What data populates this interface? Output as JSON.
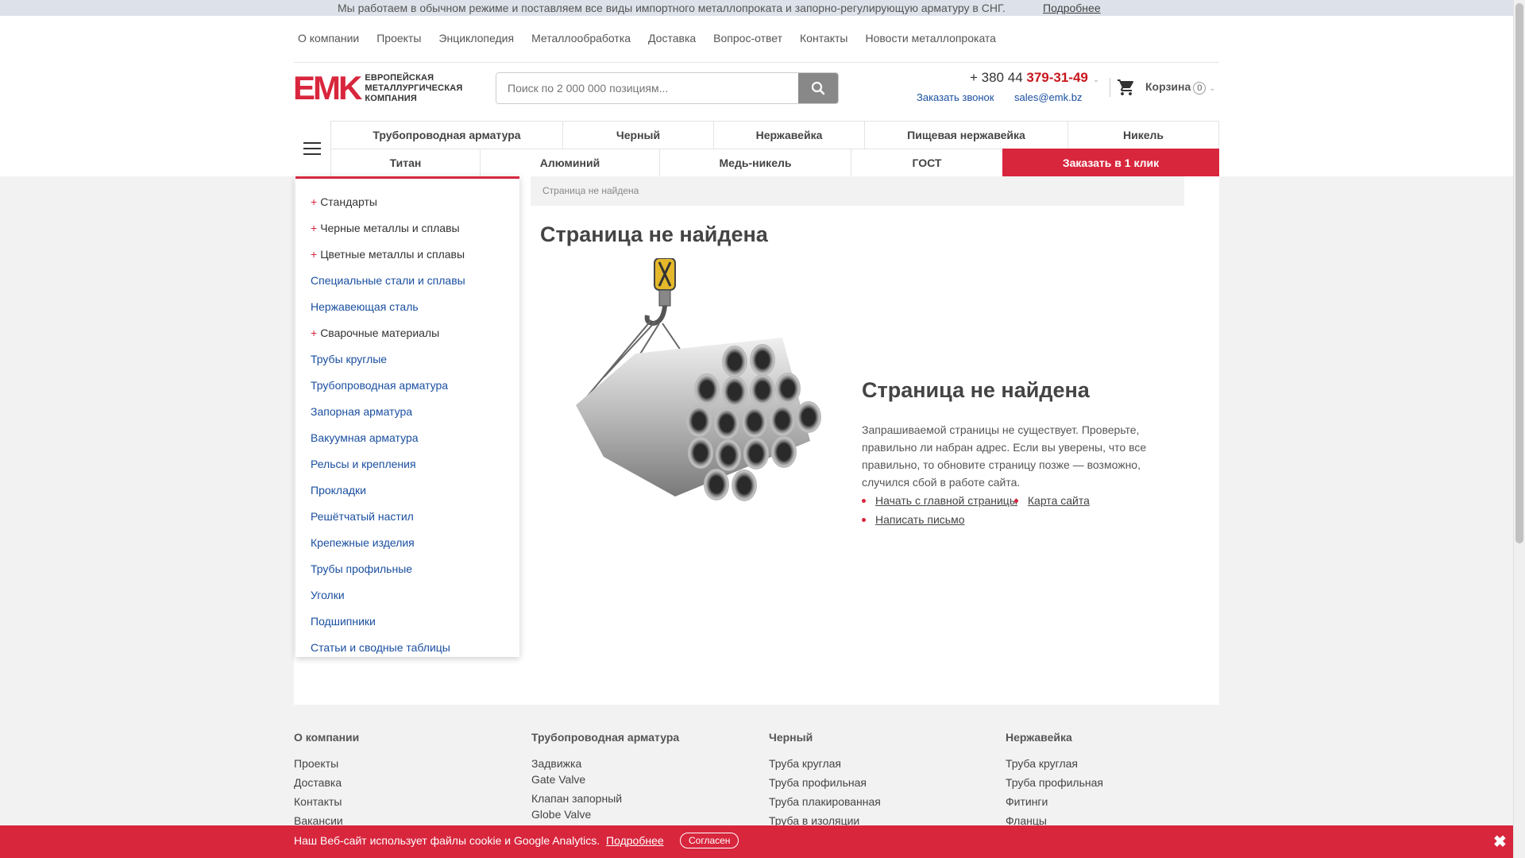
{
  "topbar": {
    "message": "Мы работаем в обычном режиме и поставляем все виды импортного металлопроката и запорно-регулирующую арматуру в СНГ.",
    "more": "Подробнее"
  },
  "topnav": [
    "О компании",
    "Проекты",
    "Энциклопедия",
    "Металлообработка",
    "Доставка",
    "Вопрос-ответ",
    "Контакты",
    "Новости металлопроката"
  ],
  "logo": {
    "mark": "EMK",
    "line1": "ЕВРОПЕЙСКАЯ",
    "line2": "МЕТАЛЛУРГИЧЕСКАЯ",
    "line3": "КОМПАНИЯ"
  },
  "search": {
    "placeholder": "Поиск по 2 000 000 позициям...",
    "icon": "search-icon"
  },
  "contacts": {
    "phone_prefix": "+ 380 44 ",
    "phone_main": "379-31-49",
    "callback": "Заказать звонок",
    "email": "sales@emk.bz"
  },
  "cart": {
    "label": "Корзина",
    "count": "0"
  },
  "catnav": {
    "row1": [
      "Трубопроводная арматура",
      "Черный",
      "Нержавейка",
      "Пищевая нержавейка",
      "Никель"
    ],
    "row2": [
      "Титан",
      "Алюминий",
      "Медь-никель",
      "ГОСТ"
    ],
    "order_button": "Заказать в 1 клик"
  },
  "sidemenu": [
    {
      "label": "Стандарты",
      "plus": true
    },
    {
      "label": "Черные металлы и сплавы",
      "plus": true
    },
    {
      "label": "Цветные металлы и сплавы",
      "plus": true
    },
    {
      "label": "Специальные стали и сплавы",
      "plus": false
    },
    {
      "label": "Нержавеющая сталь",
      "plus": false
    },
    {
      "label": "Сварочные материалы",
      "plus": true
    },
    {
      "label": "Трубы круглые",
      "plus": false
    },
    {
      "label": "Трубопроводная арматура",
      "plus": false
    },
    {
      "label": "Запорная арматура",
      "plus": false
    },
    {
      "label": "Вакуумная арматура",
      "plus": false
    },
    {
      "label": "Рельсы и крепления",
      "plus": false
    },
    {
      "label": "Прокладки",
      "plus": false
    },
    {
      "label": "Решётчатый настил",
      "plus": false
    },
    {
      "label": "Крепежные изделия",
      "plus": false
    },
    {
      "label": "Трубы профильные",
      "plus": false
    },
    {
      "label": "Уголки",
      "plus": false
    },
    {
      "label": "Подшипники",
      "plus": false
    },
    {
      "label": "Статьи и сводные таблицы",
      "plus": false
    }
  ],
  "breadcrumb": "Страница не найдена",
  "page_title": "Страница не найдена",
  "error": {
    "title": "Страница не найдена",
    "text": "Запрашиваемой страницы не существует. Проверьте, правильно ли набран адрес. Если вы уверены, что все правильно, то обновите страницу позже — возможно, случился сбой в работе сайта.",
    "link_home": "Начать с главной страницы",
    "link_sitemap": "Карта сайта",
    "link_write": "Написать письмо"
  },
  "footer": {
    "col1": {
      "title": "О компании",
      "items": [
        "Проекты",
        "Доставка",
        "Контакты",
        "Вакансии"
      ]
    },
    "col2": {
      "title": "Трубопроводная арматура",
      "items": [
        [
          "Задвижка",
          "Gate Valve"
        ],
        [
          "Клапан запорный",
          "Globe Valve"
        ]
      ]
    },
    "col3": {
      "title": "Черный",
      "items": [
        "Труба круглая",
        "Труба профильная",
        "Труба плакированная",
        "Труба в изоляции"
      ]
    },
    "col4": {
      "title": "Нержавейка",
      "items": [
        "Труба круглая",
        "Труба профильная",
        "Фитинги",
        "Фланцы"
      ]
    }
  },
  "cookie": {
    "text": "Наш Веб-сайт использует файлы cookie и Google Analytics.",
    "more": "Подробнее",
    "agree": "Согласен",
    "close": "✖"
  },
  "colors": {
    "accent": "#d8263d",
    "link": "#1a4fa0"
  }
}
